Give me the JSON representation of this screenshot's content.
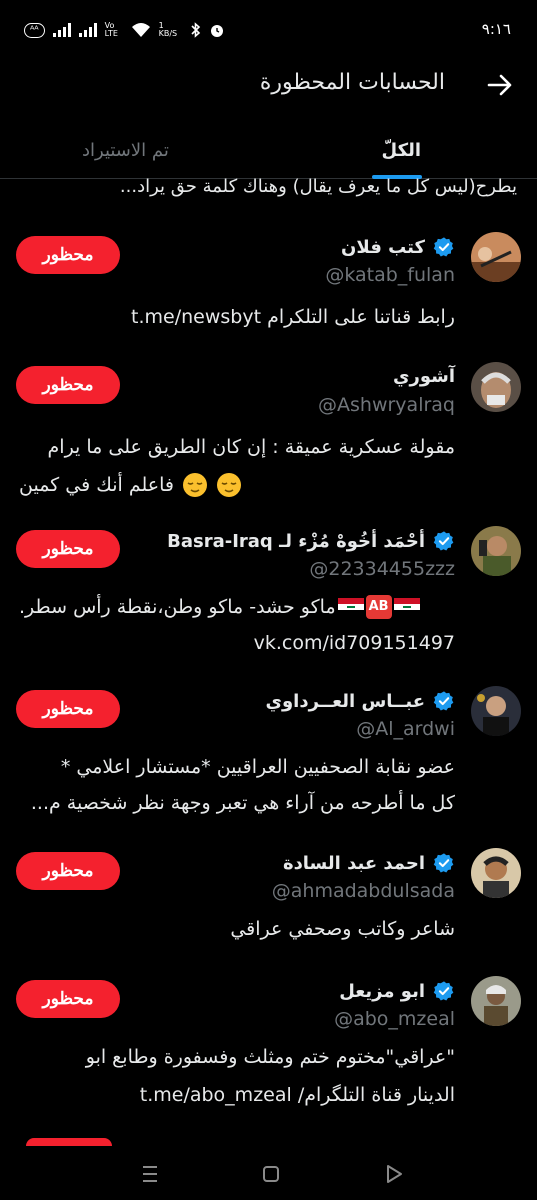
{
  "status": {
    "network_pill": "ᴬᴬ",
    "volte": "Vo LTE",
    "speed": "1 KB/S",
    "time": "٩:١٦"
  },
  "header": {
    "title": "الحسابات المحظورة"
  },
  "tabs": [
    {
      "label": "الكلّ",
      "selected": true
    },
    {
      "label": "تم الاستيراد",
      "selected": false
    }
  ],
  "clipped_line": "يطرح(ليس كل ما يعرف يقال) وهناك كلمة حق يراد...",
  "blocked_label": "محظور",
  "accounts": [
    {
      "name": "كتب فلان",
      "verified": true,
      "handle": "@katab_fulan",
      "bio": [
        "رابط قناتنا على التلكرام t.me/newsbyt"
      ]
    },
    {
      "name": "آشوري",
      "verified": false,
      "handle": "@Ashwryalraq",
      "bio": [
        "مقولة عسكرية عميقة : إن كان الطريق على ما يرام",
        "فاعلم أنك في كمين"
      ]
    },
    {
      "name": "أحْمَد أخُوهْ مُزْء لـ Basra-Iraq",
      "verified": true,
      "handle": "@22334455zzz",
      "bio": [
        "ماكو حشد- ماكو وطن،نقطة رأس سطر.",
        "vk.com/id709151497"
      ]
    },
    {
      "name": "عبــاس العــرداوي",
      "verified": true,
      "handle": "@Al_ardwi",
      "bio": [
        "عضو نقابة الصحفيين العراقيين *مستشار اعلامي *",
        "كل ما أطرحه من آراء هي تعبر وجهة نظر شخصية م..."
      ]
    },
    {
      "name": "احمد عبد السادة",
      "verified": true,
      "handle": "@ahmadabdulsada",
      "bio": [
        "شاعر وكاتب وصحفي عراقي"
      ]
    },
    {
      "name": "ابو مزيعل",
      "verified": true,
      "handle": "@abo_mzeal",
      "bio": [
        "\"عراقي\"مختوم ختم ومثلث وفسفورة وطابع ابو",
        "الدينار قناة التلگرام/ t.me/abo_mzeal"
      ]
    }
  ],
  "icons": {
    "back": "arrow-right-icon",
    "verified": "verified-badge-icon",
    "nav": [
      "recents-icon",
      "home-icon",
      "back-triangle-icon"
    ]
  },
  "colors": {
    "accent": "#1d9bf0",
    "blocked": "#f4212e",
    "muted": "#71767b",
    "bg": "#000000"
  }
}
